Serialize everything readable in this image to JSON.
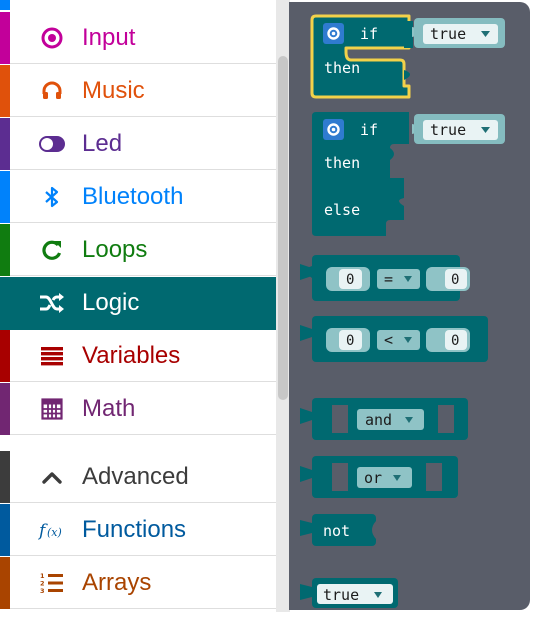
{
  "toolbox": {
    "categories": [
      {
        "label": "Input",
        "color": "#C2009A",
        "icon": "target-icon"
      },
      {
        "label": "Music",
        "color": "#E0510B",
        "icon": "headphones-icon"
      },
      {
        "label": "Led",
        "color": "#5C2D91",
        "icon": "toggle-icon"
      },
      {
        "label": "Bluetooth",
        "color": "#0082FB",
        "icon": "bluetooth-icon"
      },
      {
        "label": "Loops",
        "color": "#107C10",
        "icon": "loop-icon"
      },
      {
        "label": "Logic",
        "color": "#006970",
        "icon": "shuffle-icon",
        "selected": true
      },
      {
        "label": "Variables",
        "color": "#A80000",
        "icon": "list-lines-icon"
      },
      {
        "label": "Math",
        "color": "#712672",
        "icon": "calculator-icon"
      }
    ],
    "advanced": [
      {
        "label": "Advanced",
        "color": "#3C3C3C",
        "icon": "chevron-up-icon"
      },
      {
        "label": "Functions",
        "color": "#005A9E",
        "icon": "function-icon"
      },
      {
        "label": "Arrays",
        "color": "#A94400",
        "icon": "ordered-list-icon"
      }
    ]
  },
  "flyout": {
    "block_color": "#006970",
    "selected_outline": "#F2D14A",
    "if_block": {
      "if": "if",
      "then": "then",
      "value": "true"
    },
    "if_else_block": {
      "if": "if",
      "then": "then",
      "else": "else",
      "value": "true"
    },
    "compare_eq": {
      "left": "0",
      "op": "=",
      "right": "0"
    },
    "compare_lt": {
      "left": "0",
      "op": "<",
      "right": "0"
    },
    "and_block": {
      "op": "and"
    },
    "or_block": {
      "op": "or"
    },
    "not_block": {
      "label": "not"
    },
    "true_block": {
      "value": "true"
    }
  }
}
